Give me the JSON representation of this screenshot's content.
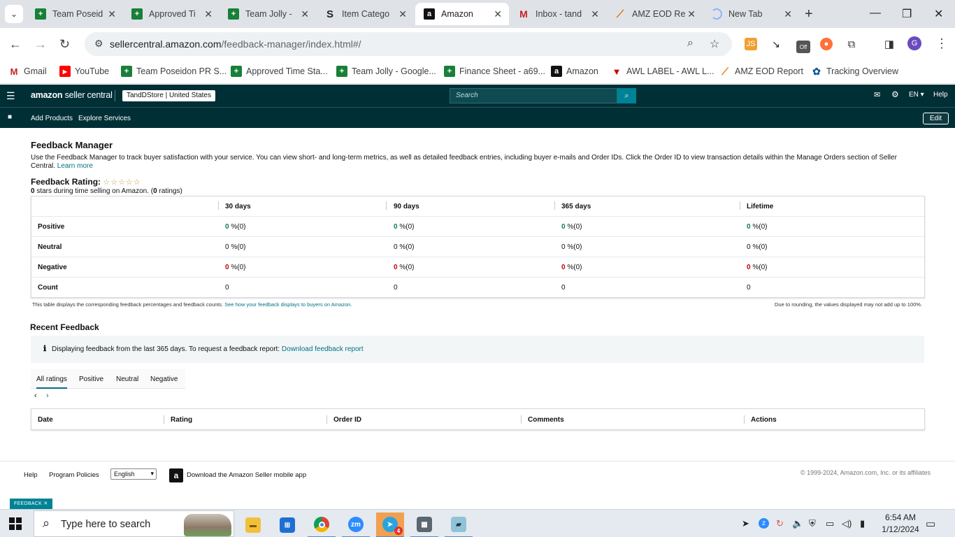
{
  "browser": {
    "tabs": [
      {
        "title": "Team Poseid",
        "icon": "sheets-icon"
      },
      {
        "title": "Approved Ti",
        "icon": "sheets-icon"
      },
      {
        "title": "Team Jolly - ",
        "icon": "sheets-icon"
      },
      {
        "title": "Item Catego",
        "icon": "s-icon"
      },
      {
        "title": "Amazon",
        "icon": "amazon-icon"
      },
      {
        "title": "Inbox - tand",
        "icon": "gmail-icon"
      },
      {
        "title": "AMZ EOD Re",
        "icon": "eod-icon"
      },
      {
        "title": "New Tab",
        "icon": "loading-icon"
      }
    ],
    "url_host": "sellercentral.amazon.com",
    "url_path": "/feedback-manager/index.html#/",
    "extension_badge": "Off",
    "profile_initial": "G",
    "bookmarks": [
      {
        "label": "Gmail"
      },
      {
        "label": "YouTube"
      },
      {
        "label": "Team Poseidon PR S..."
      },
      {
        "label": "Approved Time Sta..."
      },
      {
        "label": "Team Jolly - Google..."
      },
      {
        "label": "Finance Sheet - a69..."
      },
      {
        "label": "Amazon"
      },
      {
        "label": "AWL LABEL - AWL L..."
      },
      {
        "label": "AMZ EOD Report"
      },
      {
        "label": "Tracking Overview"
      }
    ]
  },
  "seller_central": {
    "logo_bold": "amazon",
    "logo_rest": " seller central",
    "store": "TandDStore | United States",
    "search_placeholder": "Search",
    "language": "EN",
    "help": "Help",
    "nav": {
      "add_products": "Add Products",
      "explore_services": "Explore Services",
      "edit": "Edit"
    }
  },
  "page": {
    "title": "Feedback Manager",
    "description": "Use the Feedback Manager to track buyer satisfaction with your service. You can view short- and long-term metrics, as well as detailed feedback entries, including buyer e-mails and Order IDs. Click the Order ID to view transaction details within the Manage Orders section of Seller Central.",
    "learn_more": "Learn more",
    "rating_label": "Feedback Rating:",
    "stars": "☆☆☆☆☆",
    "rating_value": "0",
    "rating_mid": " stars during time selling on Amazon. (",
    "rating_count": "0",
    "rating_end": " ratings)"
  },
  "metrics": {
    "columns": [
      "30 days",
      "90 days",
      "365 days",
      "Lifetime"
    ],
    "rows": [
      {
        "label": "Positive",
        "num": "0",
        "suffix": "%(0)",
        "color": "green"
      },
      {
        "label": "Neutral",
        "num": "0",
        "suffix": "%(0)",
        "color": "none"
      },
      {
        "label": "Negative",
        "num": "0",
        "suffix": "%(0)",
        "color": "red"
      },
      {
        "label": "Count",
        "num": "0",
        "suffix": "",
        "color": "none"
      }
    ],
    "note_left": "This table displays the corresponding feedback percentages and feedback counts.",
    "note_left_link": "See how your feedback displays to buyers on Amazon.",
    "note_right": "Due to rounding, the values displayed may not add up to 100%."
  },
  "recent": {
    "title": "Recent Feedback",
    "info": "Displaying feedback from the last 365 days. To request a feedback report:",
    "info_link": "Download feedback report",
    "tabs": [
      "All ratings",
      "Positive",
      "Neutral",
      "Negative"
    ],
    "table_headers": [
      "Date",
      "Rating",
      "Order ID",
      "Comments",
      "Actions"
    ]
  },
  "footer": {
    "help": "Help",
    "program_policies": "Program Policies",
    "language": "English",
    "app": "Download the Amazon Seller mobile app",
    "copyright": "© 1999-2024, Amazon.com, Inc. or its affiliates",
    "feedback": "FEEDBACK ✕"
  },
  "taskbar": {
    "search_placeholder": "Type here to search",
    "time": "6:54 AM",
    "date": "1/12/2024",
    "telegram_badge": "4"
  },
  "colors": {
    "sc_header": "#002f36",
    "link": "#007185",
    "positive": "#067d62",
    "negative": "#c40000"
  }
}
